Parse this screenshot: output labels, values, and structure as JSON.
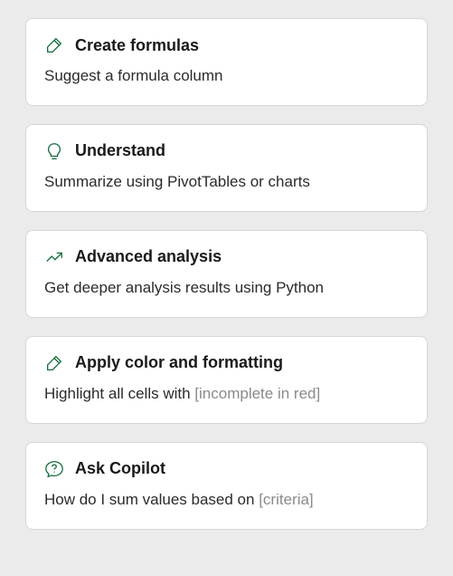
{
  "cards": [
    {
      "icon": "pencil-sparkle-icon",
      "title": "Create formulas",
      "desc": "Suggest a formula column",
      "placeholder": ""
    },
    {
      "icon": "lightbulb-icon",
      "title": "Understand",
      "desc": "Summarize using PivotTables or charts",
      "placeholder": ""
    },
    {
      "icon": "trend-icon",
      "title": "Advanced analysis",
      "desc": "Get deeper analysis results using Python",
      "placeholder": ""
    },
    {
      "icon": "pencil-icon",
      "title": "Apply color and formatting",
      "desc": "Highlight all cells with ",
      "placeholder": "[incomplete in red]"
    },
    {
      "icon": "chat-question-icon",
      "title": "Ask Copilot",
      "desc": "How do I sum values based on ",
      "placeholder": "[criteria]"
    }
  ]
}
